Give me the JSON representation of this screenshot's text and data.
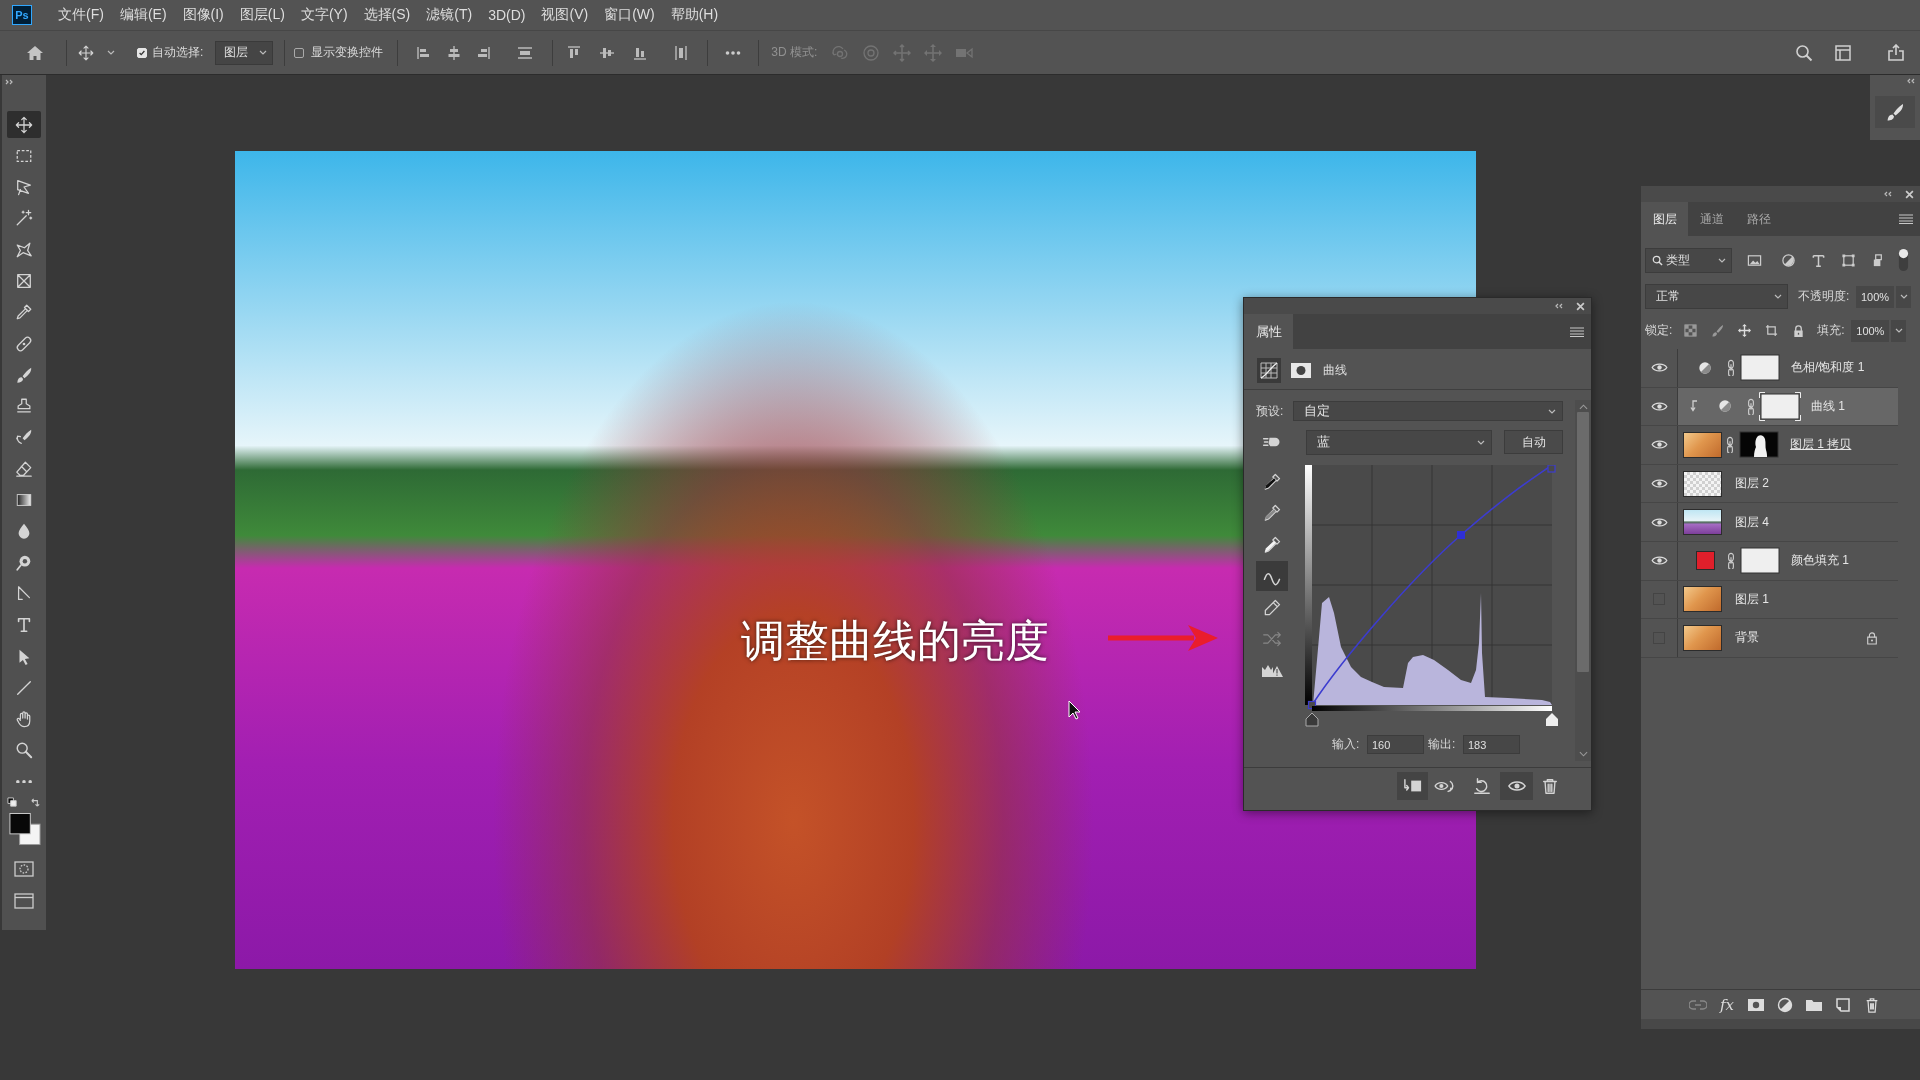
{
  "app": {
    "logo": "Ps"
  },
  "menu_bar": [
    "文件(F)",
    "编辑(E)",
    "图像(I)",
    "图层(L)",
    "文字(Y)",
    "选择(S)",
    "滤镜(T)",
    "3D(D)",
    "视图(V)",
    "窗口(W)",
    "帮助(H)"
  ],
  "options_bar": {
    "auto_select": {
      "label": "自动选择:",
      "checked": true
    },
    "auto_select_target": "图层",
    "show_transform_controls": {
      "label": "显示变换控件",
      "checked": false
    },
    "mode_3d": {
      "label": "3D 模式:",
      "disabled": true
    }
  },
  "toolbar": {
    "tools": [
      {
        "selected": true
      },
      {
        "selected": false
      },
      {
        "selected": false
      },
      {
        "selected": false
      },
      {
        "selected": false
      },
      {
        "selected": false
      },
      {
        "selected": false
      },
      {
        "selected": false
      },
      {
        "selected": false
      },
      {
        "selected": false
      },
      {
        "selected": false
      },
      {
        "selected": false
      },
      {
        "selected": false
      },
      {
        "selected": false
      },
      {
        "selected": false
      },
      {
        "selected": false
      },
      {
        "selected": false
      },
      {
        "selected": false
      },
      {
        "selected": false
      },
      {
        "selected": false
      },
      {
        "selected": false
      },
      {
        "selected": false
      }
    ]
  },
  "canvas": {
    "caption": "调整曲线的亮度"
  },
  "properties_panel": {
    "tab": "属性",
    "modes": [
      {
        "selected": true
      },
      {
        "selected": false
      }
    ],
    "adjustment": "曲线",
    "preset_label": "预设:",
    "preset": "自定",
    "channel": "蓝",
    "auto_button": "自动",
    "tools": [
      {
        "selected": false,
        "disabled": false
      },
      {
        "selected": false,
        "disabled": false
      },
      {
        "selected": false,
        "disabled": false
      },
      {
        "selected": false,
        "disabled": false
      },
      {
        "selected": true,
        "disabled": false
      },
      {
        "selected": false,
        "disabled": false
      },
      {
        "selected": false,
        "disabled": true
      },
      {
        "selected": false,
        "disabled": false
      }
    ],
    "input_label": "输入:",
    "input": "160",
    "output_label": "输出:",
    "output": "183",
    "footer_buttons": [
      {
        "on": true
      },
      {
        "on": false
      },
      {
        "on": false
      },
      {
        "on": true
      },
      {
        "on": false
      }
    ]
  },
  "layers_panel": {
    "tabs": [
      {
        "label": "图层",
        "selected": true
      },
      {
        "label": "通道",
        "selected": false
      },
      {
        "label": "路径",
        "selected": false
      }
    ],
    "filter": "类型",
    "blend_mode": "正常",
    "opacity_label": "不透明度:",
    "opacity": "100%",
    "lock_label": "锁定:",
    "fill_label": "填充:",
    "fill": "100%",
    "layers": [
      {
        "name": "色相/饱和度 1",
        "kind": "adjustment",
        "visible": true,
        "selected": false,
        "clipped": false,
        "clipping_base": false,
        "locked": false,
        "mask": {
          "kind": "plain"
        }
      },
      {
        "name": "曲线 1",
        "kind": "adjustment",
        "visible": true,
        "selected": true,
        "clipped": true,
        "clipping_base": false,
        "locked": false,
        "mask": {
          "kind": "plain"
        }
      },
      {
        "name": "图层 1 拷贝",
        "kind": "photo",
        "visible": true,
        "selected": false,
        "clipped": false,
        "clipping_base": true,
        "locked": false,
        "mask": {
          "kind": "cutout"
        }
      },
      {
        "name": "图层 2",
        "kind": "transparent",
        "visible": true,
        "selected": false,
        "clipped": false,
        "clipping_base": false,
        "locked": false
      },
      {
        "name": "图层 4",
        "kind": "scene",
        "visible": true,
        "selected": false,
        "clipped": false,
        "clipping_base": false,
        "locked": false
      },
      {
        "name": "颜色填充 1",
        "kind": "fill",
        "visible": true,
        "selected": false,
        "clipped": false,
        "clipping_base": false,
        "locked": false,
        "color": "#e01f2b",
        "mask": {
          "kind": "plain"
        }
      },
      {
        "name": "图层 1",
        "kind": "photo",
        "visible": false,
        "selected": false,
        "clipped": false,
        "clipping_base": false,
        "locked": false
      },
      {
        "name": "背景",
        "kind": "photo",
        "visible": false,
        "selected": false,
        "clipped": false,
        "clipping_base": false,
        "locked": true
      }
    ],
    "style_button": "fx"
  }
}
